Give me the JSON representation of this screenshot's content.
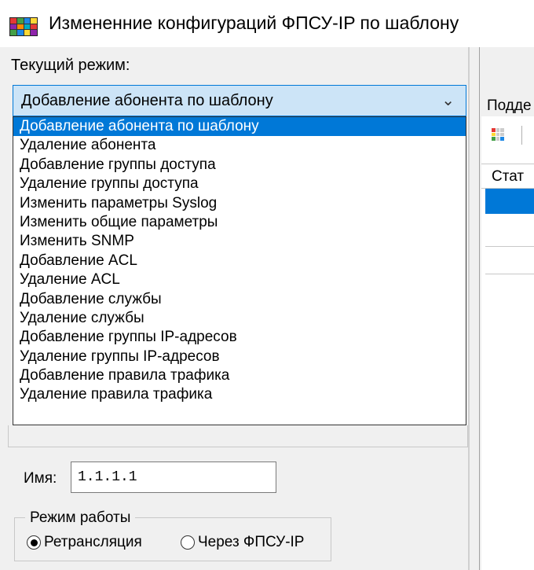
{
  "window": {
    "title": "Измененние конфигураций ФПСУ-IP по шаблону",
    "icon": "grid-app-icon"
  },
  "mode": {
    "label": "Текущий режим:",
    "selected": "Добавление абонента по шаблону",
    "options": [
      "Добавление абонента по шаблону",
      "Удаление абонента",
      "Добавление группы доступа",
      "Удаление группы доступа",
      "Изменить параметры Syslog",
      "Изменить общие параметры",
      "Изменить SNMP",
      "Добавление ACL",
      "Удаление ACL",
      "Добавление службы",
      "Удаление службы",
      "Добавление группы IP-адресов",
      "Удаление группы IP-адресов",
      "Добавление правила трафика",
      "Удаление правила трафика"
    ]
  },
  "name_field": {
    "label": "Имя:",
    "value": "1.1.1.1"
  },
  "work_mode": {
    "title": "Режим работы",
    "options": [
      {
        "label": "Ретрансляция",
        "checked": true
      },
      {
        "label": "Через ФПСУ-IP",
        "checked": false
      }
    ]
  },
  "right_panel": {
    "label": "Подде",
    "grid_header": "Стат"
  },
  "colors": {
    "selection": "#0078d7",
    "combo_bg": "#cce4f7",
    "panel_bg": "#f0f0f0"
  }
}
